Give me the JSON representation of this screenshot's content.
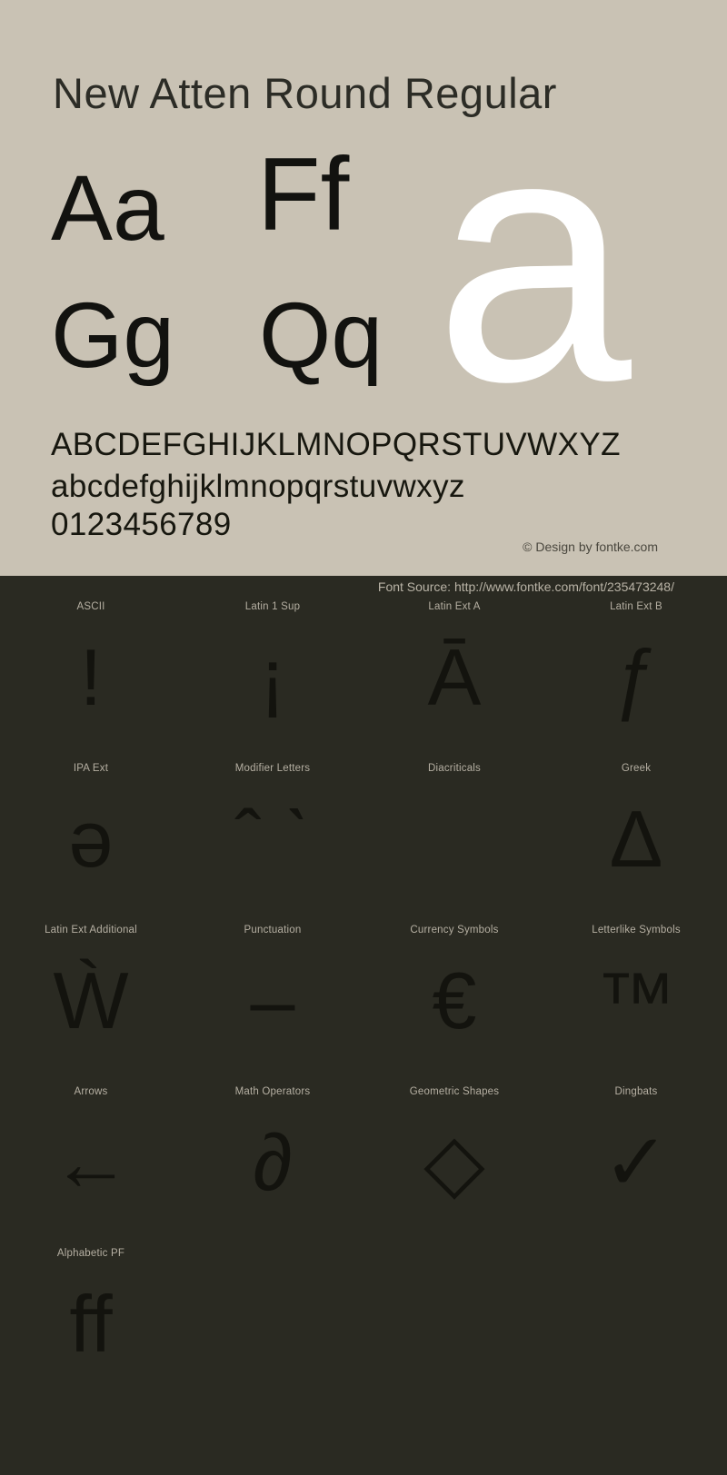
{
  "specimen": {
    "title": "New Atten Round Regular",
    "background_color": "#c9c2b4",
    "text_color": "#2c2c26",
    "pairs": [
      {
        "name": "aa",
        "text": "Aa"
      },
      {
        "name": "ff",
        "text": "Ff"
      },
      {
        "name": "gg",
        "text": "Gg"
      },
      {
        "name": "qq",
        "text": "Qq"
      }
    ],
    "showcase_glyph": "a",
    "showcase_color": "#ffffff",
    "alphabet_uppercase": "ABCDEFGHIJKLMNOPQRSTUVWXYZ",
    "alphabet_lowercase": "abcdefghijklmnopqrstuvwxyz",
    "digits": "0123456789",
    "copyright": "© Design by fontke.com"
  },
  "blocks_panel": {
    "background_color": "#2a2a22",
    "label_color": "#b5afa2",
    "glyph_color": "#13130e",
    "font_source": "Font Source: http://www.fontke.com/font/235473248/",
    "blocks": [
      {
        "label": "ASCII",
        "glyph": "!"
      },
      {
        "label": "Latin 1 Sup",
        "glyph": "¡"
      },
      {
        "label": "Latin Ext A",
        "glyph": "Ā"
      },
      {
        "label": "Latin Ext B",
        "glyph": "ƒ"
      },
      {
        "label": "IPA Ext",
        "glyph": "ə"
      },
      {
        "label": "Modifier Letters",
        "glyph": "ˆ ˋ"
      },
      {
        "label": "Diacriticals",
        "glyph": ""
      },
      {
        "label": "Greek",
        "glyph": "Δ"
      },
      {
        "label": "Latin Ext Additional",
        "glyph": "Ẁ"
      },
      {
        "label": "Punctuation",
        "glyph": "–"
      },
      {
        "label": "Currency Symbols",
        "glyph": "€"
      },
      {
        "label": "Letterlike Symbols",
        "glyph": "™"
      },
      {
        "label": "Arrows",
        "glyph": "←"
      },
      {
        "label": "Math Operators",
        "glyph": "∂"
      },
      {
        "label": "Geometric Shapes",
        "glyph": "◇"
      },
      {
        "label": "Dingbats",
        "glyph": "✓"
      },
      {
        "label": "Alphabetic PF",
        "glyph": "ff"
      }
    ]
  }
}
